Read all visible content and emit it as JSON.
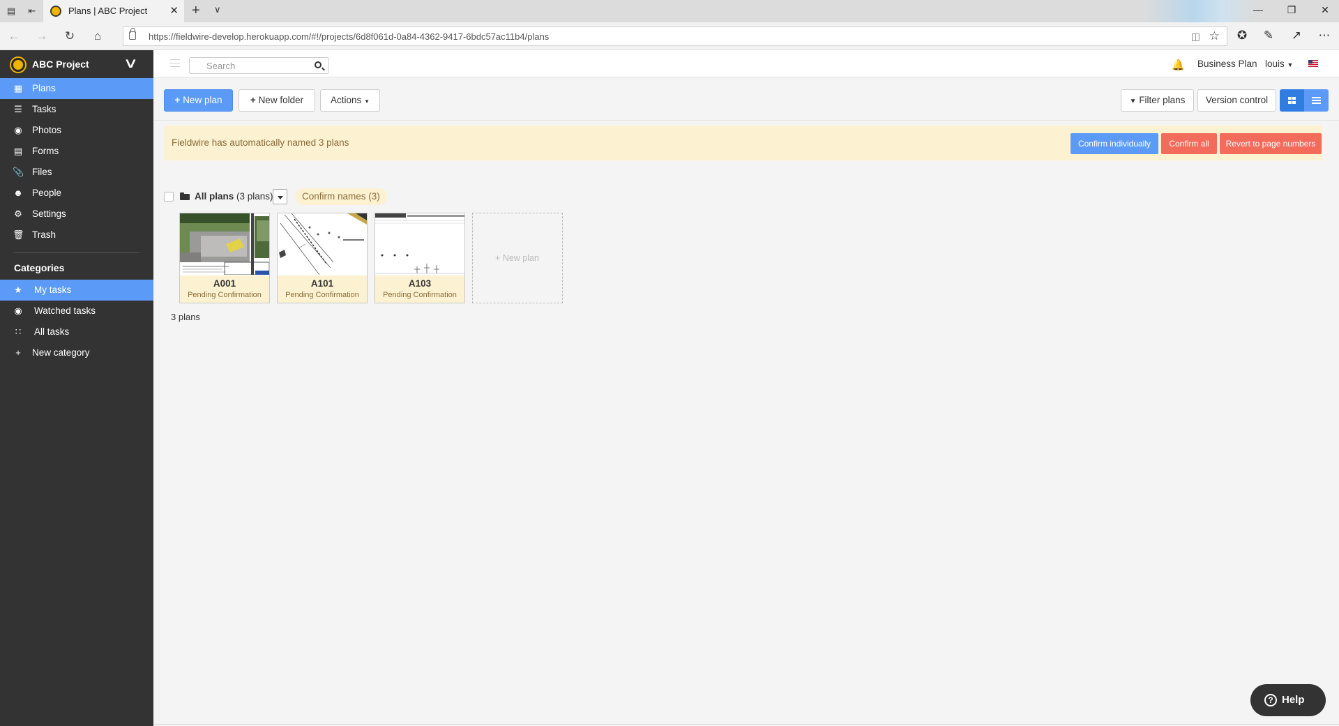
{
  "browser": {
    "tab_title": "Plans | ABC Project",
    "url": "https://fieldwire-develop.herokuapp.com/#!/projects/6d8f061d-0a84-4362-9417-6bdc57ac11b4/plans"
  },
  "sidebar": {
    "project_name": "ABC Project",
    "items": [
      {
        "label": "Plans",
        "icon": "plans-icon",
        "active": true
      },
      {
        "label": "Tasks",
        "icon": "list-icon",
        "active": false
      },
      {
        "label": "Photos",
        "icon": "camera-icon",
        "active": false
      },
      {
        "label": "Forms",
        "icon": "clipboard-icon",
        "active": false
      },
      {
        "label": "Files",
        "icon": "paperclip-icon",
        "active": false
      },
      {
        "label": "People",
        "icon": "people-icon",
        "active": false
      },
      {
        "label": "Settings",
        "icon": "gear-icon",
        "active": false
      },
      {
        "label": "Trash",
        "icon": "trash-icon",
        "active": false
      }
    ],
    "categories_title": "Categories",
    "categories": [
      {
        "label": "My tasks",
        "icon": "star-icon",
        "active": true
      },
      {
        "label": "Watched tasks",
        "icon": "eye-icon",
        "active": false
      },
      {
        "label": "All tasks",
        "icon": "grid-icon",
        "active": false
      },
      {
        "label": "New category",
        "icon": "plus-icon",
        "active": false
      }
    ]
  },
  "header": {
    "search_placeholder": "Search",
    "business_plan": "Business Plan",
    "user": "louis"
  },
  "toolbar": {
    "new_plan": "New plan",
    "new_folder": "New folder",
    "actions": "Actions",
    "filter_plans": "Filter plans",
    "version_control": "Version control"
  },
  "alert": {
    "message": "Fieldwire has automatically named 3 plans",
    "confirm_individually": "Confirm individually",
    "confirm_all": "Confirm all",
    "revert": "Revert to page numbers"
  },
  "folder": {
    "name": "All plans",
    "count": "(3 plans)",
    "confirm_names": "Confirm names (3)"
  },
  "plans": [
    {
      "name": "A001",
      "status": "Pending Confirmation"
    },
    {
      "name": "A101",
      "status": "Pending Confirmation"
    },
    {
      "name": "A103",
      "status": "Pending Confirmation"
    }
  ],
  "new_plan_card": "+ New plan",
  "plans_count": "3 plans",
  "help": "Help",
  "colors": {
    "sidebar_bg": "#333333",
    "accent_blue": "#5b9bf7",
    "alert_bg": "#fcf1d0",
    "alert_text": "#8a6d3b",
    "danger": "#f26b5b"
  }
}
